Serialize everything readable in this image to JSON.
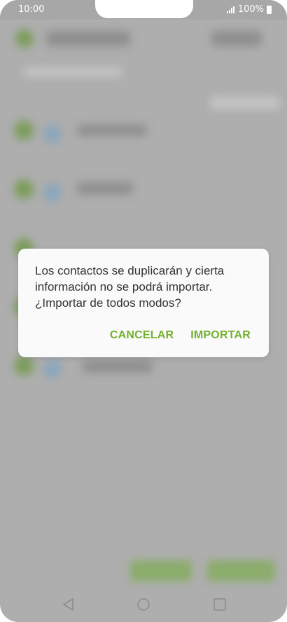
{
  "status_bar": {
    "time": "10:00",
    "battery": "100%",
    "icons": [
      "signal-icon",
      "battery-icon"
    ]
  },
  "dialog": {
    "message": "Los contactos se duplicarán y cierta información no se podrá importar. ¿Importar de todos modos?",
    "cancel_label": "CANCELAR",
    "confirm_label": "IMPORTAR"
  },
  "colors": {
    "accent": "#73b12e",
    "scrim": "#aeaeae",
    "dialog_bg": "#fafafa",
    "message_text": "#333333"
  },
  "navigation": {
    "icons": [
      "back-icon",
      "home-icon",
      "recent-apps-icon"
    ]
  }
}
